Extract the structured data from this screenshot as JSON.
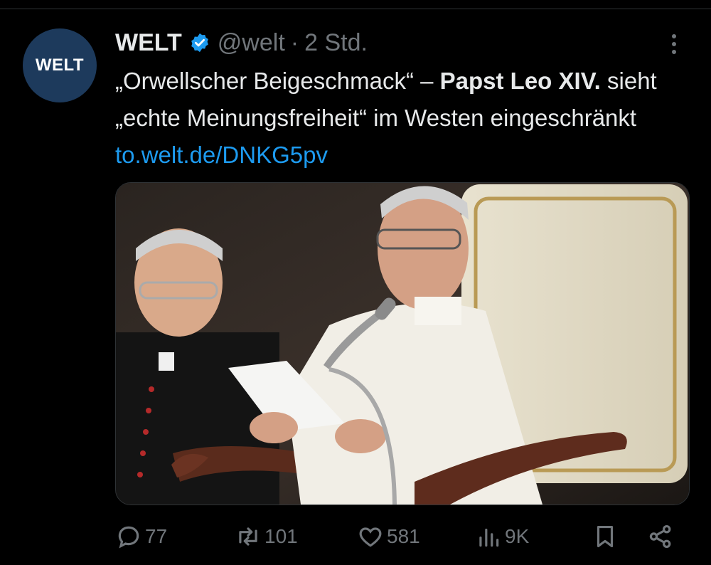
{
  "tweet": {
    "author_name": "WELT",
    "avatar_text": "WELT",
    "handle": "@welt",
    "separator": "·",
    "time": "2 Std.",
    "text_part1": "„Orwellscher Beigeschmack“ – ",
    "text_bold": "Papst Leo XIV.",
    "text_part2": " sieht „echte Meinungsfreiheit“ im Westen eingeschränkt ",
    "link": "to.welt.de/DNKG5pv"
  },
  "actions": {
    "reply_count": "77",
    "retweet_count": "101",
    "like_count": "581",
    "views_count": "9K"
  },
  "colors": {
    "background": "#000000",
    "text": "#e7e9ea",
    "muted": "#71767b",
    "link": "#1d9bf0",
    "avatar_bg": "#1d3a5c"
  },
  "icons": [
    "verified-badge-icon",
    "more-icon",
    "reply-icon",
    "retweet-icon",
    "like-icon",
    "views-icon",
    "bookmark-icon",
    "share-icon"
  ]
}
